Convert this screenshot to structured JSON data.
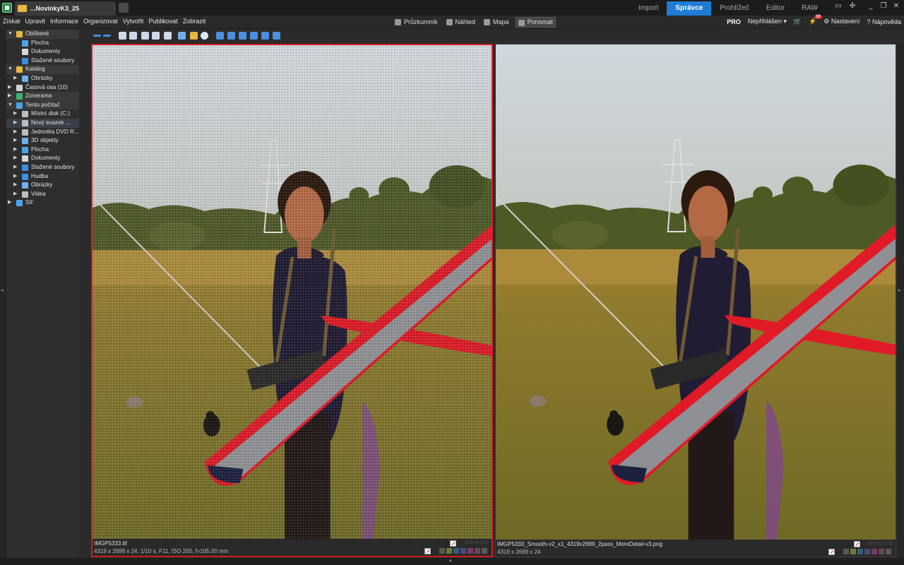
{
  "titlebar": {
    "document_tab": "...NovinkyK3_25",
    "mode_tabs": [
      {
        "label": "Import",
        "active": false
      },
      {
        "label": "Správce",
        "active": true
      },
      {
        "label": "Prohlížeč",
        "active": false
      },
      {
        "label": "Editor",
        "active": false
      },
      {
        "label": "RAW",
        "active": false
      }
    ],
    "window_controls": [
      "screen-icon",
      "expand-icon",
      "minimize-icon",
      "restore-icon",
      "close-icon"
    ]
  },
  "menubar": {
    "items": [
      "Získat",
      "Upravit",
      "Informace",
      "Organizovat",
      "Vytvořit",
      "Publikovat",
      "Zobrazit"
    ],
    "view_switch": [
      {
        "label": "Průzkumník",
        "icon": "explorer-icon",
        "active": false
      },
      {
        "label": "Náhled",
        "icon": "preview-icon",
        "active": false
      },
      {
        "label": "Mapa",
        "icon": "map-icon",
        "active": false
      },
      {
        "label": "Porovnat",
        "icon": "compare-icon",
        "active": true
      }
    ],
    "pro_label": "PRO",
    "login_label": "Nepřihlášen",
    "notifications_count": "10",
    "settings_label": "Nastavení",
    "help_label": "Nápověda"
  },
  "sidebar": {
    "items": [
      {
        "label": "Oblíbené",
        "level": 0,
        "header": true,
        "expanded": true,
        "icon": "favorites-icon",
        "color": "#e8b840"
      },
      {
        "label": "Plocha",
        "level": 1,
        "header": false,
        "icon": "desktop-icon",
        "color": "#4aa3e8"
      },
      {
        "label": "Dokumenty",
        "level": 1,
        "header": false,
        "icon": "documents-icon",
        "color": "#d8d8d8"
      },
      {
        "label": "Stažené soubory",
        "level": 1,
        "header": false,
        "icon": "downloads-icon",
        "color": "#3d8ee0"
      },
      {
        "label": "Katalog",
        "level": 0,
        "header": true,
        "expanded": true,
        "icon": "catalog-icon",
        "color": "#e8b840"
      },
      {
        "label": "Obrázky",
        "level": 1,
        "header": false,
        "expandable": true,
        "icon": "pictures-icon",
        "color": "#6fb0e8"
      },
      {
        "label": "Časová osa (10)",
        "level": 0,
        "header": false,
        "expandable": true,
        "icon": "timeline-icon",
        "color": "#d0d0d0"
      },
      {
        "label": "Zonerama",
        "level": 0,
        "header": true,
        "expandable": true,
        "icon": "zonerama-icon",
        "color": "#3cb371"
      },
      {
        "label": "Tento počítač",
        "level": 0,
        "header": true,
        "expanded": true,
        "icon": "computer-icon",
        "color": "#4aa3e8"
      },
      {
        "label": "Místní disk (C:)",
        "level": 1,
        "header": false,
        "expandable": true,
        "icon": "drive-icon",
        "color": "#bdbdbd"
      },
      {
        "label": "Nový svazek ...",
        "level": 1,
        "header": false,
        "expandable": true,
        "selected": true,
        "icon": "drive-icon",
        "color": "#bdbdbd"
      },
      {
        "label": "Jednotka DVD R...",
        "level": 1,
        "header": false,
        "expandable": true,
        "icon": "dvd-icon",
        "color": "#bdbdbd"
      },
      {
        "label": "3D objekty",
        "level": 1,
        "header": false,
        "expandable": true,
        "icon": "3d-objects-icon",
        "color": "#6fb0e8"
      },
      {
        "label": "Plocha",
        "level": 1,
        "header": false,
        "expandable": true,
        "icon": "desktop-icon",
        "color": "#4aa3e8"
      },
      {
        "label": "Dokumenty",
        "level": 1,
        "header": false,
        "expandable": true,
        "icon": "documents-icon",
        "color": "#d8d8d8"
      },
      {
        "label": "Stažené soubory",
        "level": 1,
        "header": false,
        "expandable": true,
        "icon": "downloads-icon",
        "color": "#3d8ee0"
      },
      {
        "label": "Hudba",
        "level": 1,
        "header": false,
        "expandable": true,
        "icon": "music-icon",
        "color": "#3d8ee0"
      },
      {
        "label": "Obrázky",
        "level": 1,
        "header": false,
        "expandable": true,
        "icon": "pictures-icon",
        "color": "#6fb0e8"
      },
      {
        "label": "Videa",
        "level": 1,
        "header": false,
        "expandable": true,
        "icon": "videos-icon",
        "color": "#bdbdbd"
      },
      {
        "label": "Síť",
        "level": 0,
        "header": false,
        "expandable": true,
        "icon": "network-icon",
        "color": "#4aa3e8"
      }
    ]
  },
  "toolbar": {
    "buttons": [
      "back-icon",
      "forward-icon",
      "zoom-in-icon",
      "zoom-out-icon",
      "fit-icon",
      "actual-size-icon",
      "zoom-fit-icon",
      "histogram-icon",
      "highlight-icon",
      "info-icon",
      "layout-single-icon",
      "layout-horizontal-icon",
      "layout-vertical-icon",
      "layout-rows-icon",
      "layout-columns-icon",
      "layout-grid-icon"
    ]
  },
  "panes": [
    {
      "filename": "IMGP5333.tif",
      "metadata": "4319 x 2699 x 24, 1/10 s, F11, ISO 200, f=105.00 mm",
      "rating": 0,
      "active": true
    },
    {
      "filename": "IMGP5333_Smooth-v2_x1_4319x2699_2pass_MoreDetail-v3.png",
      "metadata": "4319 x 2699 x 24",
      "rating": 0,
      "active": false
    }
  ],
  "colors": {
    "accent": "#1e7cd6",
    "active_pane_border": "#cc1f1f",
    "color_labels": [
      "#5a5a4a",
      "#6b7a3a",
      "#3a5a7a",
      "#4a4a7a",
      "#7a3a6a",
      "#6a4a4a",
      "#5a5a5a"
    ]
  }
}
